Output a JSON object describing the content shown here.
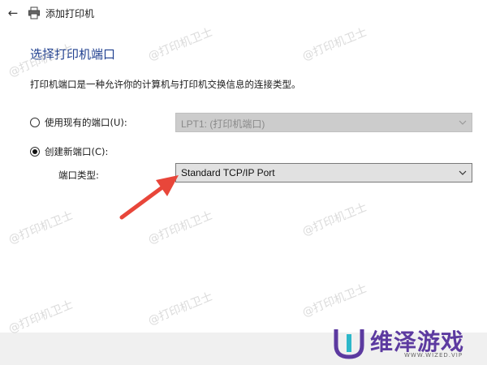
{
  "window": {
    "title": "添加打印机"
  },
  "page": {
    "heading": "选择打印机端口",
    "description": "打印机端口是一种允许你的计算机与打印机交换信息的连接类型。"
  },
  "use_existing_port": {
    "label": "使用现有的端口(U):",
    "selected": false,
    "value": "LPT1: (打印机端口)",
    "enabled": false
  },
  "create_new_port": {
    "label": "创建新端口(C):",
    "selected": true,
    "type_label": "端口类型:",
    "type_value": "Standard TCP/IP Port"
  },
  "watermark": {
    "text": "@打印机卫士"
  },
  "logo": {
    "text": "维泽游戏",
    "subtitle": "WWW.WIZED.VIP"
  },
  "colors": {
    "heading": "#1f3f8f",
    "arrow": "#e8463a",
    "logo": "#5c3aa0"
  }
}
